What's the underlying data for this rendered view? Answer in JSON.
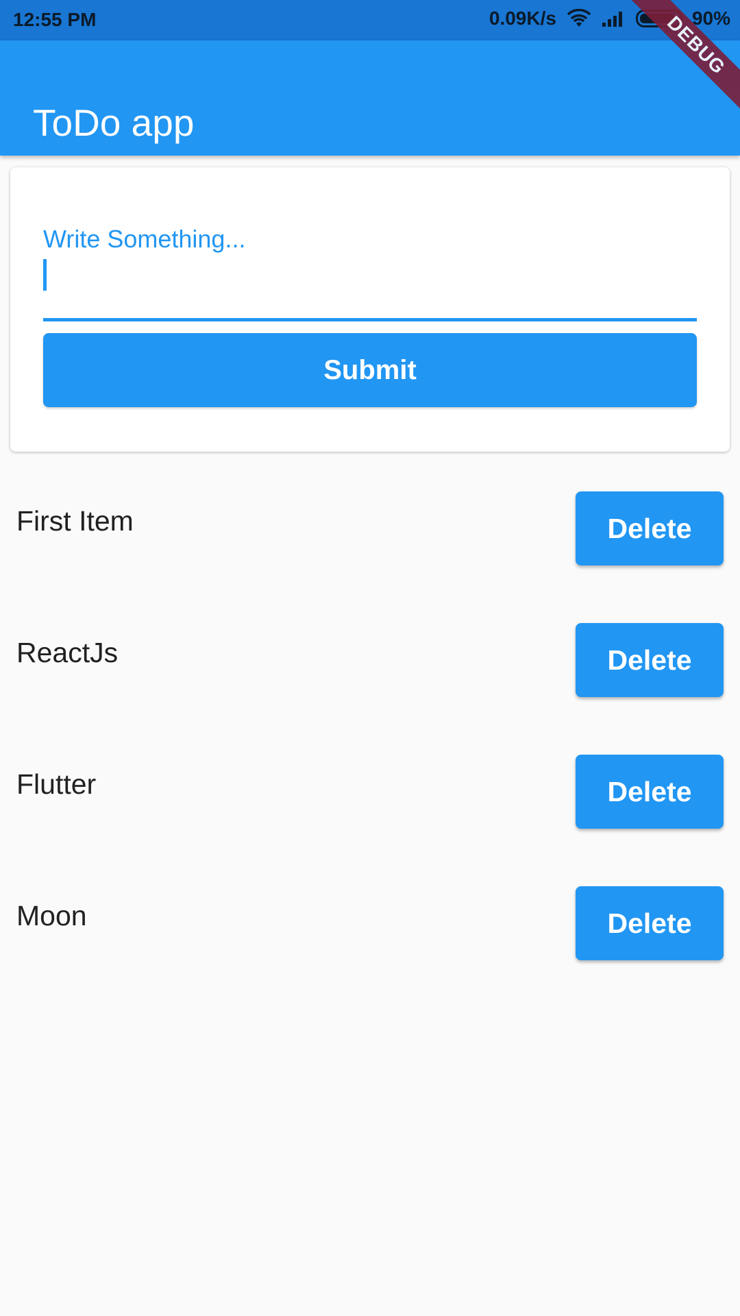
{
  "status_bar": {
    "time": "12:55 PM",
    "network_speed": "0.09K/s",
    "battery_percent": "90%",
    "battery_level": 0.9,
    "icons": [
      "wifi-icon",
      "signal-icon",
      "battery-icon"
    ]
  },
  "app_bar": {
    "title": "ToDo app",
    "background_color": "#2196F3"
  },
  "debug_banner": {
    "label": "DEBUG"
  },
  "form": {
    "label": "Write Something...",
    "value": "",
    "submit_label": "Submit",
    "accent_color": "#2196F3"
  },
  "todos": [
    {
      "text": "First Item",
      "delete_label": "Delete"
    },
    {
      "text": "ReactJs",
      "delete_label": "Delete"
    },
    {
      "text": "Flutter",
      "delete_label": "Delete"
    },
    {
      "text": "Moon",
      "delete_label": "Delete"
    }
  ]
}
